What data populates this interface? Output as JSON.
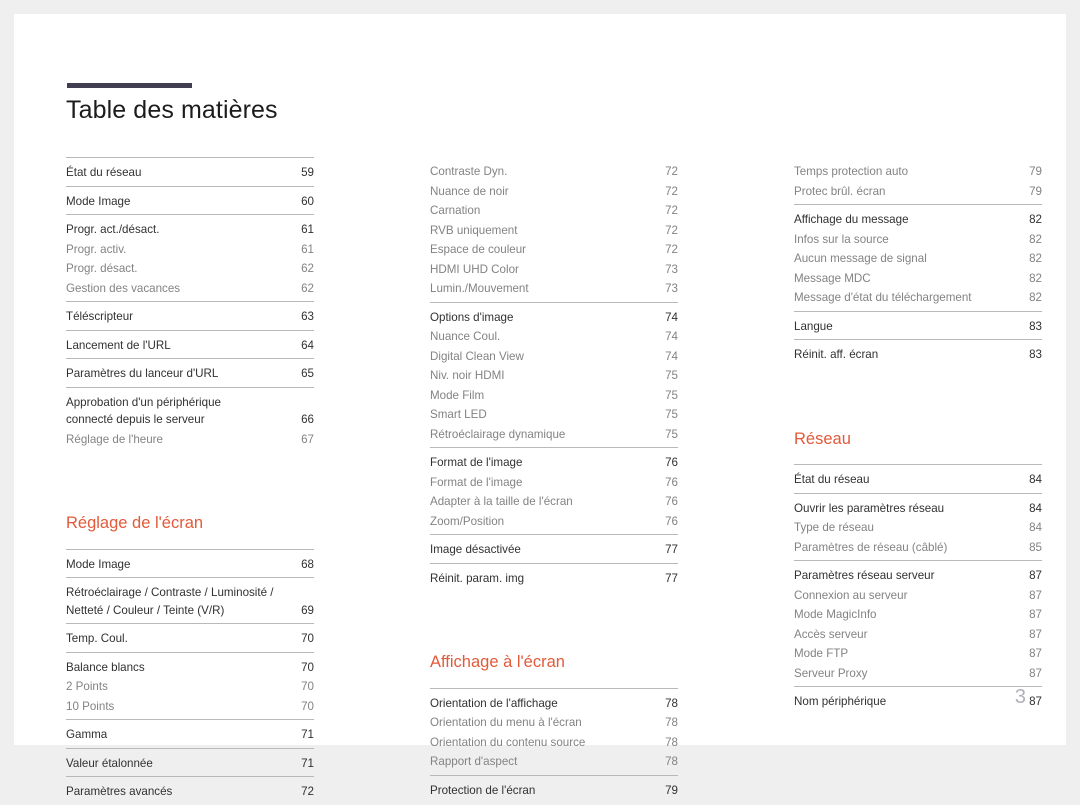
{
  "document": {
    "title": "Table des matières",
    "page_number": "3",
    "accent_color": "#e25a3a",
    "title_bar_color": "#403e50"
  },
  "columns": [
    {
      "id": "column-1",
      "blocks": [
        {
          "kind": "group",
          "entries": [
            {
              "label": [
                "État du réseau"
              ],
              "page": "59",
              "level": "main"
            }
          ]
        },
        {
          "kind": "group",
          "entries": [
            {
              "label": [
                "Mode Image"
              ],
              "page": "60",
              "level": "main"
            }
          ]
        },
        {
          "kind": "group",
          "entries": [
            {
              "label": [
                "Progr. act./désact."
              ],
              "page": "61",
              "level": "main"
            },
            {
              "label": [
                "Progr. activ."
              ],
              "page": "61",
              "level": "sub"
            },
            {
              "label": [
                "Progr. désact."
              ],
              "page": "62",
              "level": "sub"
            },
            {
              "label": [
                "Gestion des vacances"
              ],
              "page": "62",
              "level": "sub"
            }
          ]
        },
        {
          "kind": "group",
          "entries": [
            {
              "label": [
                "Téléscripteur"
              ],
              "page": "63",
              "level": "main"
            }
          ]
        },
        {
          "kind": "group",
          "entries": [
            {
              "label": [
                "Lancement de l'URL"
              ],
              "page": "64",
              "level": "main"
            }
          ]
        },
        {
          "kind": "group",
          "entries": [
            {
              "label": [
                "Paramètres du lanceur d'URL"
              ],
              "page": "65",
              "level": "main"
            }
          ]
        },
        {
          "kind": "group",
          "entries": [
            {
              "label": [
                "Approbation d'un périphérique",
                "connecté depuis le serveur"
              ],
              "page": "66",
              "level": "main"
            },
            {
              "label": [
                "Réglage de l'heure"
              ],
              "page": "67",
              "level": "sub"
            }
          ]
        },
        {
          "kind": "heading",
          "text": "Réglage de l'écran",
          "spacing": "large"
        },
        {
          "kind": "group",
          "entries": [
            {
              "label": [
                "Mode Image"
              ],
              "page": "68",
              "level": "main"
            }
          ]
        },
        {
          "kind": "group",
          "entries": [
            {
              "label": [
                "Rétroéclairage / Contraste / Luminosité /",
                "Netteté / Couleur / Teinte (V/R)"
              ],
              "page": "69",
              "level": "main"
            }
          ]
        },
        {
          "kind": "group",
          "entries": [
            {
              "label": [
                "Temp. Coul."
              ],
              "page": "70",
              "level": "main"
            }
          ]
        },
        {
          "kind": "group",
          "entries": [
            {
              "label": [
                "Balance blancs"
              ],
              "page": "70",
              "level": "main"
            },
            {
              "label": [
                "2 Points"
              ],
              "page": "70",
              "level": "sub"
            },
            {
              "label": [
                "10 Points"
              ],
              "page": "70",
              "level": "sub"
            }
          ]
        },
        {
          "kind": "group",
          "entries": [
            {
              "label": [
                "Gamma"
              ],
              "page": "71",
              "level": "main"
            }
          ]
        },
        {
          "kind": "group",
          "entries": [
            {
              "label": [
                "Valeur étalonnée"
              ],
              "page": "71",
              "level": "main"
            }
          ]
        },
        {
          "kind": "group",
          "entries": [
            {
              "label": [
                "Paramètres avancés"
              ],
              "page": "72",
              "level": "main"
            }
          ]
        }
      ]
    },
    {
      "id": "column-2",
      "blocks": [
        {
          "kind": "group-noline",
          "entries": [
            {
              "label": [
                "Contraste Dyn."
              ],
              "page": "72",
              "level": "sub"
            },
            {
              "label": [
                "Nuance de noir"
              ],
              "page": "72",
              "level": "sub"
            },
            {
              "label": [
                "Carnation"
              ],
              "page": "72",
              "level": "sub"
            },
            {
              "label": [
                "RVB uniquement"
              ],
              "page": "72",
              "level": "sub"
            },
            {
              "label": [
                "Espace de couleur"
              ],
              "page": "72",
              "level": "sub"
            },
            {
              "label": [
                "HDMI UHD Color"
              ],
              "page": "73",
              "level": "sub"
            },
            {
              "label": [
                "Lumin./Mouvement"
              ],
              "page": "73",
              "level": "sub"
            }
          ]
        },
        {
          "kind": "group",
          "entries": [
            {
              "label": [
                "Options d'image"
              ],
              "page": "74",
              "level": "main"
            },
            {
              "label": [
                "Nuance Coul."
              ],
              "page": "74",
              "level": "sub"
            },
            {
              "label": [
                "Digital Clean View"
              ],
              "page": "74",
              "level": "sub"
            },
            {
              "label": [
                "Niv. noir HDMI"
              ],
              "page": "75",
              "level": "sub"
            },
            {
              "label": [
                "Mode Film"
              ],
              "page": "75",
              "level": "sub"
            },
            {
              "label": [
                "Smart LED"
              ],
              "page": "75",
              "level": "sub"
            },
            {
              "label": [
                "Rétroéclairage dynamique"
              ],
              "page": "75",
              "level": "sub"
            }
          ]
        },
        {
          "kind": "group",
          "entries": [
            {
              "label": [
                "Format de l'image"
              ],
              "page": "76",
              "level": "main"
            },
            {
              "label": [
                "Format de l'image"
              ],
              "page": "76",
              "level": "sub"
            },
            {
              "label": [
                "Adapter à la taille de l'écran"
              ],
              "page": "76",
              "level": "sub"
            },
            {
              "label": [
                "Zoom/Position"
              ],
              "page": "76",
              "level": "sub"
            }
          ]
        },
        {
          "kind": "group",
          "entries": [
            {
              "label": [
                "Image désactivée"
              ],
              "page": "77",
              "level": "main"
            }
          ]
        },
        {
          "kind": "group",
          "entries": [
            {
              "label": [
                "Réinit. param. img"
              ],
              "page": "77",
              "level": "main"
            }
          ]
        },
        {
          "kind": "heading",
          "text": "Affichage à l'écran",
          "spacing": "large"
        },
        {
          "kind": "group",
          "entries": [
            {
              "label": [
                "Orientation de l'affichage"
              ],
              "page": "78",
              "level": "main"
            },
            {
              "label": [
                "Orientation du menu à l'écran"
              ],
              "page": "78",
              "level": "sub"
            },
            {
              "label": [
                "Orientation du contenu source"
              ],
              "page": "78",
              "level": "sub"
            },
            {
              "label": [
                "Rapport d'aspect"
              ],
              "page": "78",
              "level": "sub"
            }
          ]
        },
        {
          "kind": "group",
          "entries": [
            {
              "label": [
                "Protection de l'écran"
              ],
              "page": "79",
              "level": "main"
            }
          ]
        }
      ]
    },
    {
      "id": "column-3",
      "blocks": [
        {
          "kind": "group-noline",
          "entries": [
            {
              "label": [
                "Temps protection auto"
              ],
              "page": "79",
              "level": "sub"
            },
            {
              "label": [
                "Protec brûl. écran"
              ],
              "page": "79",
              "level": "sub"
            }
          ]
        },
        {
          "kind": "group",
          "entries": [
            {
              "label": [
                "Affichage du message"
              ],
              "page": "82",
              "level": "main"
            },
            {
              "label": [
                "Infos sur la source"
              ],
              "page": "82",
              "level": "sub"
            },
            {
              "label": [
                "Aucun message de signal"
              ],
              "page": "82",
              "level": "sub"
            },
            {
              "label": [
                "Message MDC"
              ],
              "page": "82",
              "level": "sub"
            },
            {
              "label": [
                "Message d'état du téléchargement"
              ],
              "page": "82",
              "level": "sub"
            }
          ]
        },
        {
          "kind": "group",
          "entries": [
            {
              "label": [
                "Langue"
              ],
              "page": "83",
              "level": "main"
            }
          ]
        },
        {
          "kind": "group",
          "entries": [
            {
              "label": [
                "Réinit. aff. écran"
              ],
              "page": "83",
              "level": "main"
            }
          ]
        },
        {
          "kind": "heading",
          "text": "Réseau",
          "spacing": "large"
        },
        {
          "kind": "group",
          "entries": [
            {
              "label": [
                "État du réseau"
              ],
              "page": "84",
              "level": "main"
            }
          ]
        },
        {
          "kind": "group",
          "entries": [
            {
              "label": [
                "Ouvrir les paramètres réseau"
              ],
              "page": "84",
              "level": "main"
            },
            {
              "label": [
                "Type de réseau"
              ],
              "page": "84",
              "level": "sub"
            },
            {
              "label": [
                "Paramètres de réseau (câblé)"
              ],
              "page": "85",
              "level": "sub"
            }
          ]
        },
        {
          "kind": "group",
          "entries": [
            {
              "label": [
                "Paramètres réseau serveur"
              ],
              "page": "87",
              "level": "main"
            },
            {
              "label": [
                "Connexion au serveur"
              ],
              "page": "87",
              "level": "sub"
            },
            {
              "label": [
                "Mode MagicInfo"
              ],
              "page": "87",
              "level": "sub"
            },
            {
              "label": [
                "Accès serveur"
              ],
              "page": "87",
              "level": "sub"
            },
            {
              "label": [
                "Mode FTP"
              ],
              "page": "87",
              "level": "sub"
            },
            {
              "label": [
                "Serveur Proxy"
              ],
              "page": "87",
              "level": "sub"
            }
          ]
        },
        {
          "kind": "group",
          "entries": [
            {
              "label": [
                "Nom périphérique"
              ],
              "page": "87",
              "level": "main"
            }
          ]
        }
      ]
    }
  ]
}
